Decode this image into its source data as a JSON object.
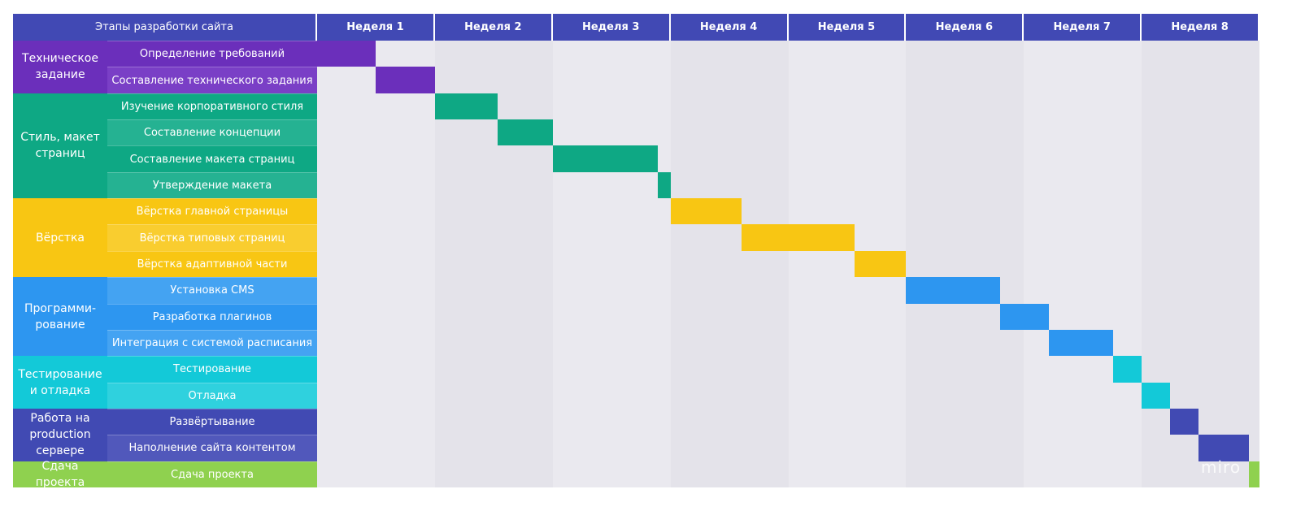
{
  "header": {
    "stages_label": "Этапы разработки сайта",
    "weeks": [
      "Неделя 1",
      "Неделя 2",
      "Неделя 3",
      "Неделя 4",
      "Неделя 5",
      "Неделя 6",
      "Неделя 7",
      "Неделя 8"
    ]
  },
  "groups": [
    {
      "label": "Техническое задание",
      "color": "#6b2fbb",
      "task_colors": [
        "#6b2fbb",
        "#7a3fc6"
      ],
      "tasks": [
        "Определение требований",
        "Составление технического задания"
      ]
    },
    {
      "label": "Стиль, макет страниц",
      "color": "#0ea884",
      "task_colors": [
        "#0ea884",
        "#25b292",
        "#0ea884",
        "#25b292"
      ],
      "tasks": [
        "Изучение корпоративного стиля",
        "Составление концепции",
        "Составление макета страниц",
        "Утверждение макета"
      ]
    },
    {
      "label": "Вёрстка",
      "color": "#f8c613",
      "task_colors": [
        "#f8c613",
        "#f9cd2f",
        "#f8c613"
      ],
      "tasks": [
        "Вёрстка главной страницы",
        "Вёрстка типовых страниц",
        "Вёрстка адаптивной части"
      ]
    },
    {
      "label": "Программи-рование",
      "color": "#2d96f0",
      "task_colors": [
        "#44a3f2",
        "#2d96f0",
        "#44a3f2"
      ],
      "tasks": [
        "Установка CMS",
        "Разработка плагинов",
        "Интеграция с системой расписания"
      ]
    },
    {
      "label": "Тестирование и отладка",
      "color": "#13c9d8",
      "task_colors": [
        "#13c9d8",
        "#2fd1de"
      ],
      "tasks": [
        "Тестирование",
        "Отладка"
      ]
    },
    {
      "label": "Работа на production сервере",
      "color": "#414ab3",
      "task_colors": [
        "#414ab3",
        "#5158bb"
      ],
      "tasks": [
        "Развёртывание",
        "Наполнение сайта контентом"
      ]
    },
    {
      "label": "Сдача проекта",
      "color": "#8fd14f",
      "task_colors": [
        "#8fd14f"
      ],
      "tasks": [
        "Сдача проекта"
      ]
    }
  ],
  "schedule_weeks": [
    [
      0.0,
      0.5
    ],
    [
      0.5,
      1.0
    ],
    [
      1.0,
      1.53
    ],
    [
      1.53,
      2.0
    ],
    [
      2.0,
      2.89
    ],
    [
      2.89,
      3.0
    ],
    [
      3.0,
      3.6
    ],
    [
      3.6,
      4.56
    ],
    [
      4.56,
      5.0
    ],
    [
      5.0,
      5.8
    ],
    [
      5.8,
      6.21
    ],
    [
      6.21,
      6.76
    ],
    [
      6.76,
      7.0
    ],
    [
      7.0,
      7.24
    ],
    [
      7.24,
      7.48
    ],
    [
      7.48,
      7.91
    ],
    [
      7.91,
      8.0
    ]
  ],
  "colors": {
    "header": "#4149b4",
    "grid_light": "#eae9ef",
    "grid_dark": "#e4e3ea"
  },
  "watermark": "miro"
}
